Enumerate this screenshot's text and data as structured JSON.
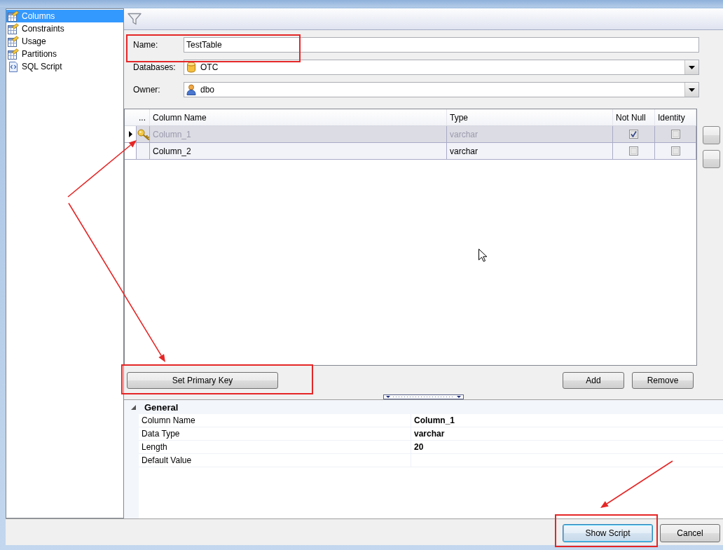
{
  "sidebar": {
    "items": [
      {
        "label": "Columns",
        "kind": "table",
        "selected": true
      },
      {
        "label": "Constraints",
        "kind": "table",
        "selected": false
      },
      {
        "label": "Usage",
        "kind": "table",
        "selected": false
      },
      {
        "label": "Partitions",
        "kind": "table",
        "selected": false
      },
      {
        "label": "SQL Script",
        "kind": "script",
        "selected": false
      }
    ]
  },
  "form": {
    "fields": [
      {
        "label": "Name:",
        "value": "TestTable",
        "kind": "text"
      },
      {
        "label": "Databases:",
        "value": "OTC",
        "kind": "database"
      },
      {
        "label": "Owner:",
        "value": "dbo",
        "kind": "user"
      }
    ]
  },
  "grid": {
    "columns": [
      "...",
      "Column Name",
      "Type",
      "Not Null",
      "Identity"
    ],
    "rows": [
      {
        "selected": true,
        "primary_key": true,
        "name": "Column_1",
        "type": "varchar",
        "not_null": true,
        "identity": false
      },
      {
        "selected": false,
        "primary_key": false,
        "name": "Column_2",
        "type": "varchar",
        "not_null": false,
        "identity": false
      }
    ]
  },
  "grid_actions": {
    "left": [
      "Set Primary Key"
    ],
    "right": [
      "Add",
      "Remove"
    ]
  },
  "properties": {
    "category": "General",
    "expanded": true,
    "rows": [
      {
        "name": "Column Name",
        "value": "Column_1"
      },
      {
        "name": "Data Type",
        "value": "varchar"
      },
      {
        "name": "Length",
        "value": "20"
      },
      {
        "name": "Default Value"
      }
    ]
  },
  "footer": {
    "buttons": [
      {
        "label": "Show Script",
        "focused": true
      },
      {
        "label": "Cancel",
        "focused": false
      }
    ]
  }
}
